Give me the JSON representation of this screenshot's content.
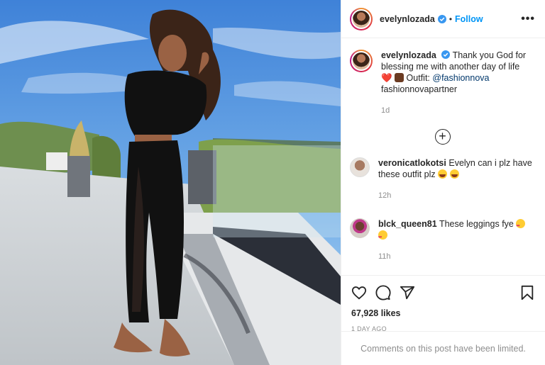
{
  "post": {
    "username": "evelynlozada",
    "verified": true,
    "separator": "•",
    "follow_label": "Follow",
    "more_label": "•••",
    "caption": {
      "username": "evelynlozada",
      "text_part1": "Thank you God for blessing me with another day of life",
      "heart": "❤️",
      "text_part2": "Outfit:",
      "mention": "@fashionnova",
      "hashtag_line": "fashionnovapartner",
      "time": "1d"
    },
    "load_more_label": "+",
    "comments": [
      {
        "username": "veronicatlokotsi",
        "text": "Evelyn can i plz have these outfit plz",
        "time": "12h"
      },
      {
        "username": "blck_queen81",
        "text": "These leggings fye",
        "time": "11h"
      }
    ],
    "likes": "67,928 likes",
    "date": "1 DAY AGO",
    "comments_limited": "Comments on this post have been limited."
  },
  "colors": {
    "accent": "#0095f6",
    "muted": "#8e8e8e",
    "text": "#262626",
    "heart": "#e0245e"
  },
  "icons": [
    "verified-icon",
    "more-options-icon",
    "add-comments-icon",
    "like-icon",
    "comment-icon",
    "share-icon",
    "save-icon"
  ]
}
